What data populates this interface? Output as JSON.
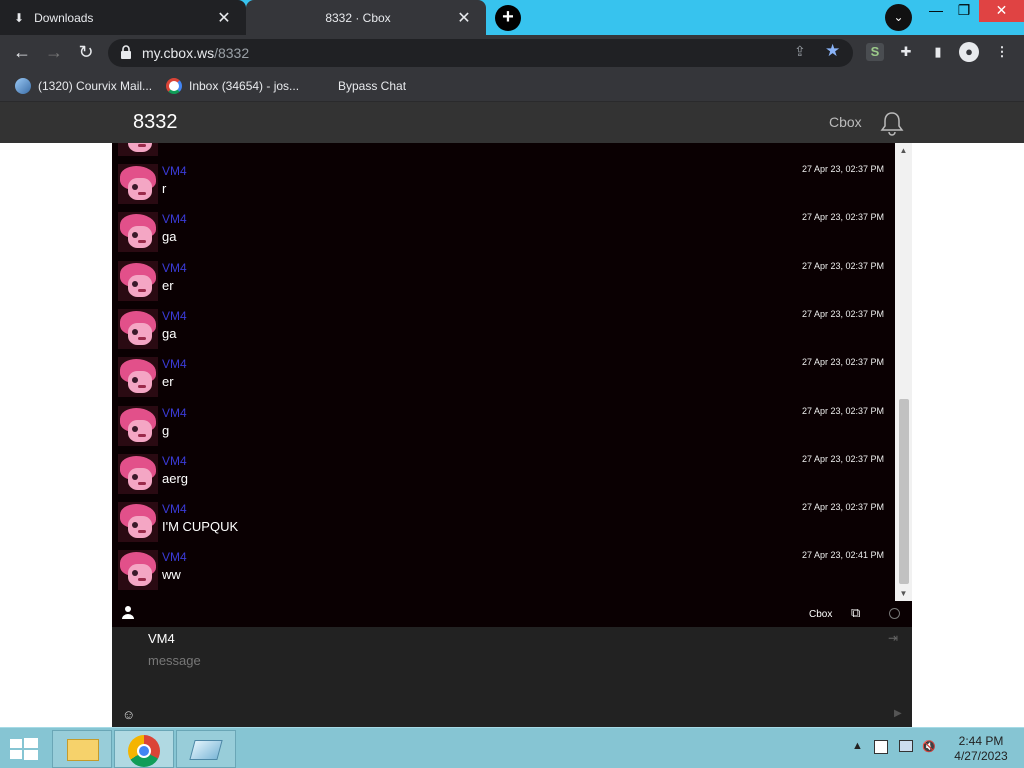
{
  "browser": {
    "tabs": [
      {
        "label": "Downloads",
        "icon": "download-icon"
      },
      {
        "label": "8332 · Cbox",
        "active": true
      }
    ],
    "url_host": "my.cbox.ws",
    "url_path": "/8332",
    "bookmarks": [
      {
        "label": "(1320) Courvix Mail...",
        "icon": "courvix-icon"
      },
      {
        "label": "Inbox (34654) - jos...",
        "icon": "gmail-icon"
      },
      {
        "label": "Bypass Chat"
      }
    ],
    "accent_color": "#37c3ee"
  },
  "app": {
    "title": "8332",
    "brand": "Cbox"
  },
  "chat": {
    "messages": [
      {
        "user": "VM4",
        "time": "27 Apr 23, 02:37 PM",
        "text": "r"
      },
      {
        "user": "VM4",
        "time": "27 Apr 23, 02:37 PM",
        "text": "ga"
      },
      {
        "user": "VM4",
        "time": "27 Apr 23, 02:37 PM",
        "text": "er"
      },
      {
        "user": "VM4",
        "time": "27 Apr 23, 02:37 PM",
        "text": "ga"
      },
      {
        "user": "VM4",
        "time": "27 Apr 23, 02:37 PM",
        "text": "er"
      },
      {
        "user": "VM4",
        "time": "27 Apr 23, 02:37 PM",
        "text": "g"
      },
      {
        "user": "VM4",
        "time": "27 Apr 23, 02:37 PM",
        "text": "aerg"
      },
      {
        "user": "VM4",
        "time": "27 Apr 23, 02:37 PM",
        "text": "I'M CUPQUK"
      },
      {
        "user": "VM4",
        "time": "27 Apr 23, 02:41 PM",
        "text": "ww"
      }
    ],
    "username_color": "#3b3bd8",
    "bar_brand": "Cbox"
  },
  "composer": {
    "name": "VM4",
    "placeholder": "message"
  },
  "taskbar": {
    "time": "2:44 PM",
    "date": "4/27/2023"
  }
}
